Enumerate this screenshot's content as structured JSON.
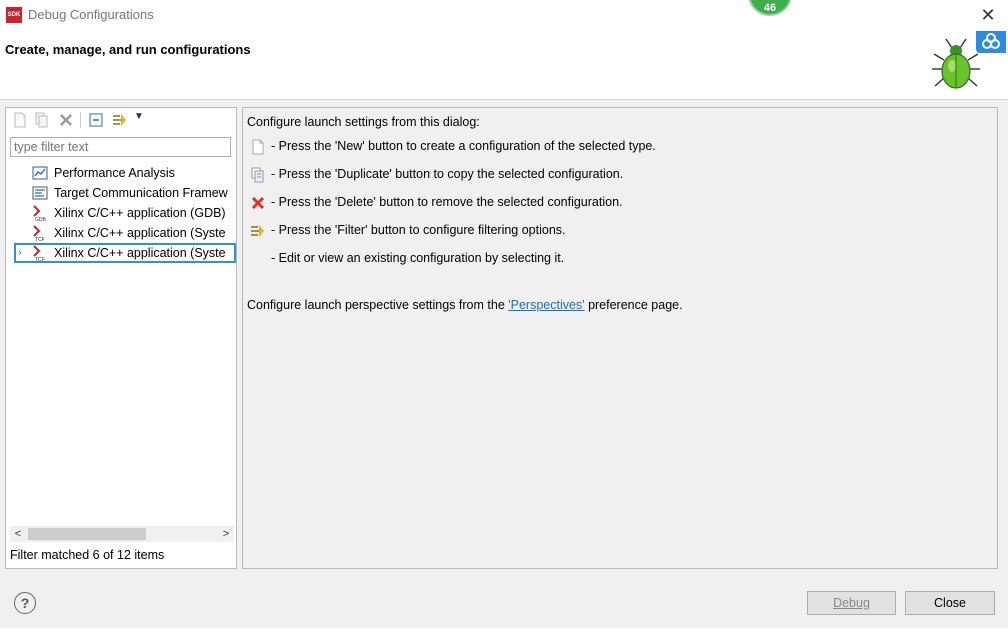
{
  "window": {
    "app_icon_text": "SDK",
    "title": "Debug Configurations",
    "close_glyph": "✕",
    "badge_count": "46"
  },
  "banner": {
    "title": "Create, manage, and run configurations",
    "icon": "bug-icon"
  },
  "left": {
    "toolbar_icons": [
      "new-config-icon",
      "duplicate-icon",
      "delete-icon",
      "collapse-all-icon",
      "filter-icon",
      "dropdown-arrow-icon"
    ],
    "filter_placeholder": "type filter text",
    "tree": [
      {
        "label": "Performance Analysis",
        "icon": "chart-icon"
      },
      {
        "label": "Target Communication Framew",
        "icon": "tcf-icon"
      },
      {
        "label": "Xilinx C/C++ application (GDB)",
        "icon": "xilinx-gdb-icon"
      },
      {
        "label": "Xilinx C/C++ application (Syste",
        "icon": "xilinx-tcf-icon"
      },
      {
        "label": "Xilinx C/C++ application (Syste",
        "icon": "xilinx-tcf-icon",
        "selected": true
      }
    ],
    "expand_arrow": "›",
    "scroll_left": "<",
    "scroll_right": ">",
    "status": "Filter matched 6 of 12 items"
  },
  "right": {
    "intro": "Configure launch settings from this dialog:",
    "lines": [
      {
        "icon": "new-config-icon",
        "text": "- Press the 'New' button to create a configuration of the selected type."
      },
      {
        "icon": "duplicate-icon",
        "text": "- Press the 'Duplicate' button to copy the selected configuration."
      },
      {
        "icon": "delete-icon",
        "text": "- Press the 'Delete' button to remove the selected configuration."
      },
      {
        "icon": "filter-icon",
        "text": "- Press the 'Filter' button to configure filtering options."
      },
      {
        "icon": "",
        "text": "- Edit or view an existing configuration by selecting it."
      }
    ],
    "perspective_prefix": "Configure launch perspective settings from the ",
    "perspective_link": "'Perspectives'",
    "perspective_suffix": " preference page."
  },
  "buttons": {
    "help": "?",
    "debug": "Debug",
    "close": "Close"
  },
  "colors": {
    "accent": "#3092d4",
    "link": "#1a6fc4",
    "badge": "#3fae49",
    "delete": "#d9342b"
  }
}
